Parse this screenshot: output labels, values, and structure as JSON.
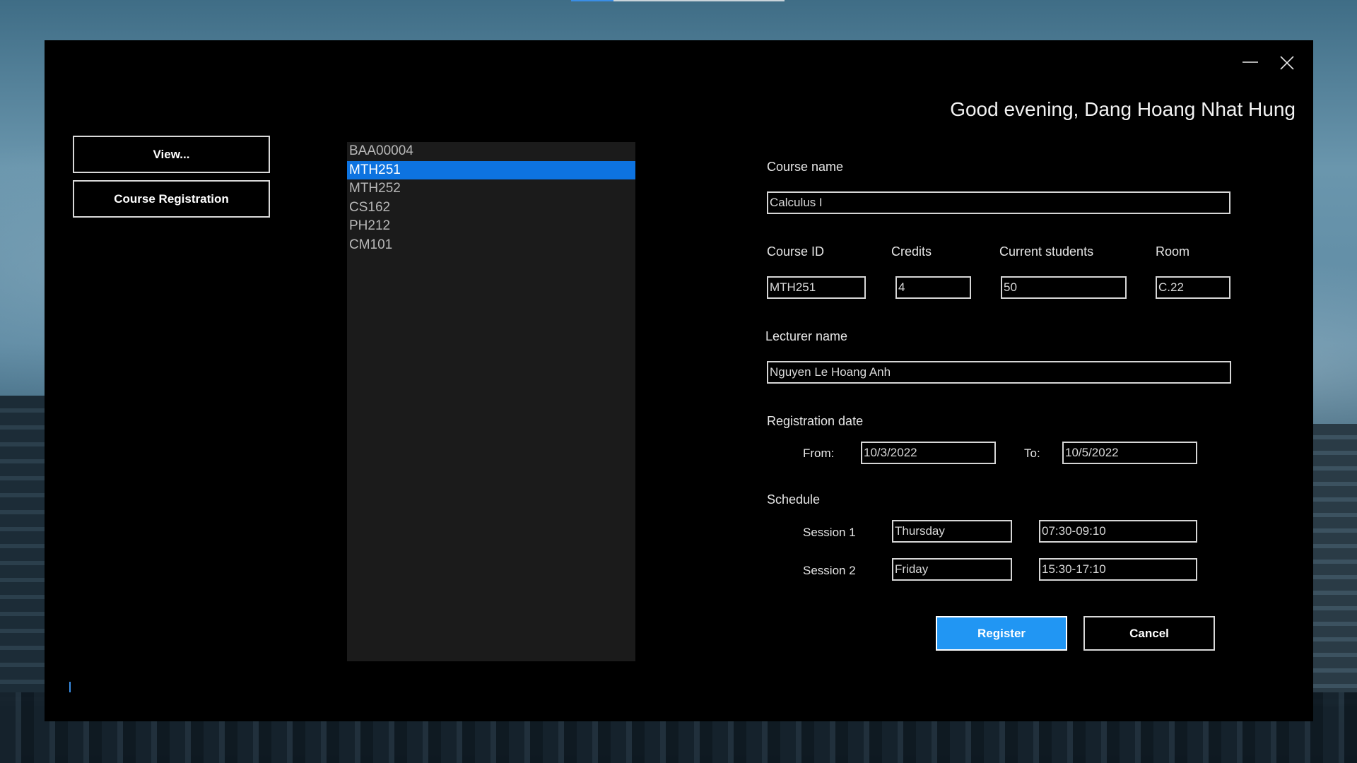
{
  "window": {
    "greeting": "Good evening, Dang Hoang Nhat Hung",
    "minimize_icon": "minimize-icon",
    "close_icon": "close-icon"
  },
  "nav": {
    "view_label": "View...",
    "registration_label": "Course Registration"
  },
  "course_list": {
    "items": [
      "BAA00004",
      "MTH251",
      "MTH252",
      "CS162",
      "PH212",
      "CM101"
    ],
    "selected": "MTH251"
  },
  "form": {
    "course_name_label": "Course name",
    "course_name_value": "Calculus I",
    "course_id_label": "Course ID",
    "course_id_value": "MTH251",
    "credits_label": "Credits",
    "credits_value": "4",
    "current_students_label": "Current students",
    "current_students_value": "50",
    "room_label": "Room",
    "room_value": "C.22",
    "lecturer_label": "Lecturer name",
    "lecturer_value": "Nguyen Le Hoang Anh",
    "registration_date_label": "Registration date",
    "from_label": "From:",
    "from_value": "10/3/2022",
    "to_label": "To:",
    "to_value": "10/5/2022",
    "schedule_label": "Schedule",
    "session1_label": "Session 1",
    "session1_day": "Thursday",
    "session1_time": "07:30-09:10",
    "session2_label": "Session 2",
    "session2_day": "Friday",
    "session2_time": "15:30-17:10"
  },
  "actions": {
    "register_label": "Register",
    "cancel_label": "Cancel"
  },
  "colors": {
    "accent": "#2196f3",
    "selection": "#0d73e0",
    "window_bg": "#000000",
    "list_bg": "#1b1b1b"
  }
}
